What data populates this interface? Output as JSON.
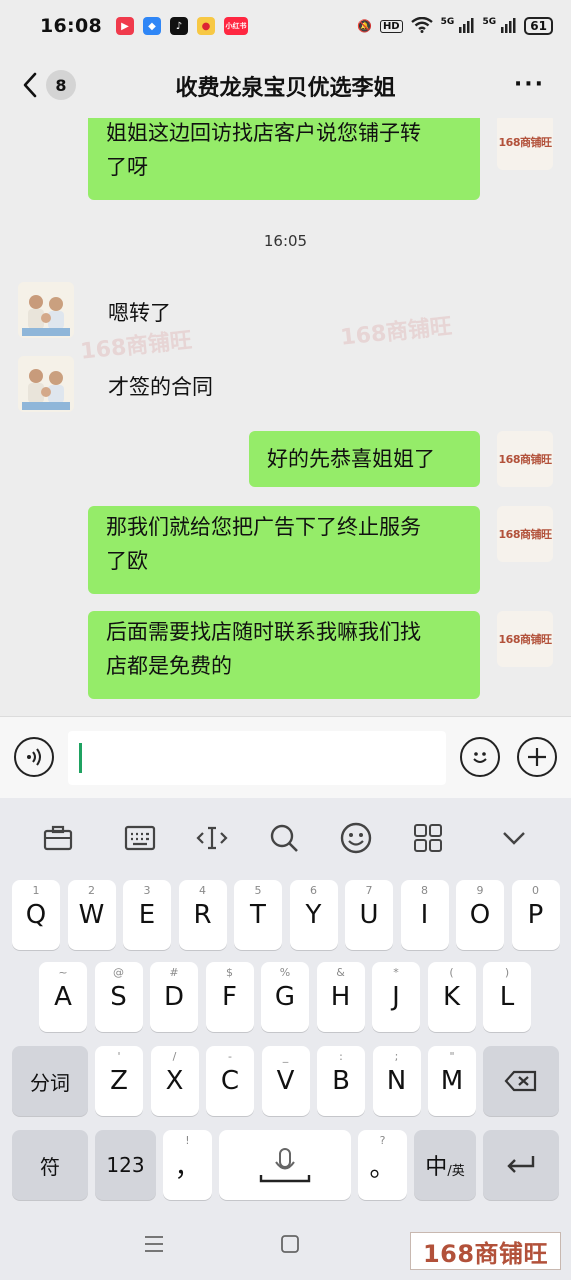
{
  "status_bar": {
    "time": "16:08",
    "battery": "61",
    "hd_label": "HD",
    "net_label": "5G",
    "weibo_label": "小红书"
  },
  "nav": {
    "back_count": "8",
    "title": "收费龙泉宝贝优选李姐",
    "more_label": "···"
  },
  "brand": {
    "name": "168商铺旺"
  },
  "messages": [
    {
      "id": "m1",
      "direction": "out",
      "text_line1": "姐姐这边回访找店客户说您铺子转",
      "text_line2": "了呀"
    },
    {
      "id": "t1",
      "direction": "time",
      "text": "16:05"
    },
    {
      "id": "m2",
      "direction": "in",
      "text": "嗯转了"
    },
    {
      "id": "m3",
      "direction": "in",
      "text": "才签的合同"
    },
    {
      "id": "m4",
      "direction": "out",
      "text": "好的先恭喜姐姐了"
    },
    {
      "id": "m5",
      "direction": "out",
      "text_line1": "那我们就给您把广告下了终止服务",
      "text_line2": "了欧"
    },
    {
      "id": "m6",
      "direction": "out",
      "text_line1": "后面需要找店随时联系我嘛我们找",
      "text_line2": "店都是免费的"
    }
  ],
  "input": {
    "value": ""
  },
  "keyboard": {
    "row1": [
      {
        "key": "Q",
        "sub": "1"
      },
      {
        "key": "W",
        "sub": "2"
      },
      {
        "key": "E",
        "sub": "3"
      },
      {
        "key": "R",
        "sub": "4"
      },
      {
        "key": "T",
        "sub": "5"
      },
      {
        "key": "Y",
        "sub": "6"
      },
      {
        "key": "U",
        "sub": "7"
      },
      {
        "key": "I",
        "sub": "8"
      },
      {
        "key": "O",
        "sub": "9"
      },
      {
        "key": "P",
        "sub": "0"
      }
    ],
    "row2": [
      {
        "key": "A",
        "sub": "~"
      },
      {
        "key": "S",
        "sub": "@"
      },
      {
        "key": "D",
        "sub": "#"
      },
      {
        "key": "F",
        "sub": "$"
      },
      {
        "key": "G",
        "sub": "%"
      },
      {
        "key": "H",
        "sub": "&"
      },
      {
        "key": "J",
        "sub": "*"
      },
      {
        "key": "K",
        "sub": "("
      },
      {
        "key": "L",
        "sub": ")"
      }
    ],
    "row3": [
      {
        "key": "Z",
        "sub": "'"
      },
      {
        "key": "X",
        "sub": "/"
      },
      {
        "key": "C",
        "sub": "-"
      },
      {
        "key": "V",
        "sub": "_"
      },
      {
        "key": "B",
        "sub": ":"
      },
      {
        "key": "N",
        "sub": ";"
      },
      {
        "key": "M",
        "sub": "\""
      }
    ],
    "fn": {
      "segment": "分词",
      "symbol": "符",
      "num": "123",
      "comma": "，",
      "comma_sub": "!",
      "period": "。",
      "period_sub": "?",
      "lang_main": "中",
      "lang_sub": "/英"
    }
  }
}
